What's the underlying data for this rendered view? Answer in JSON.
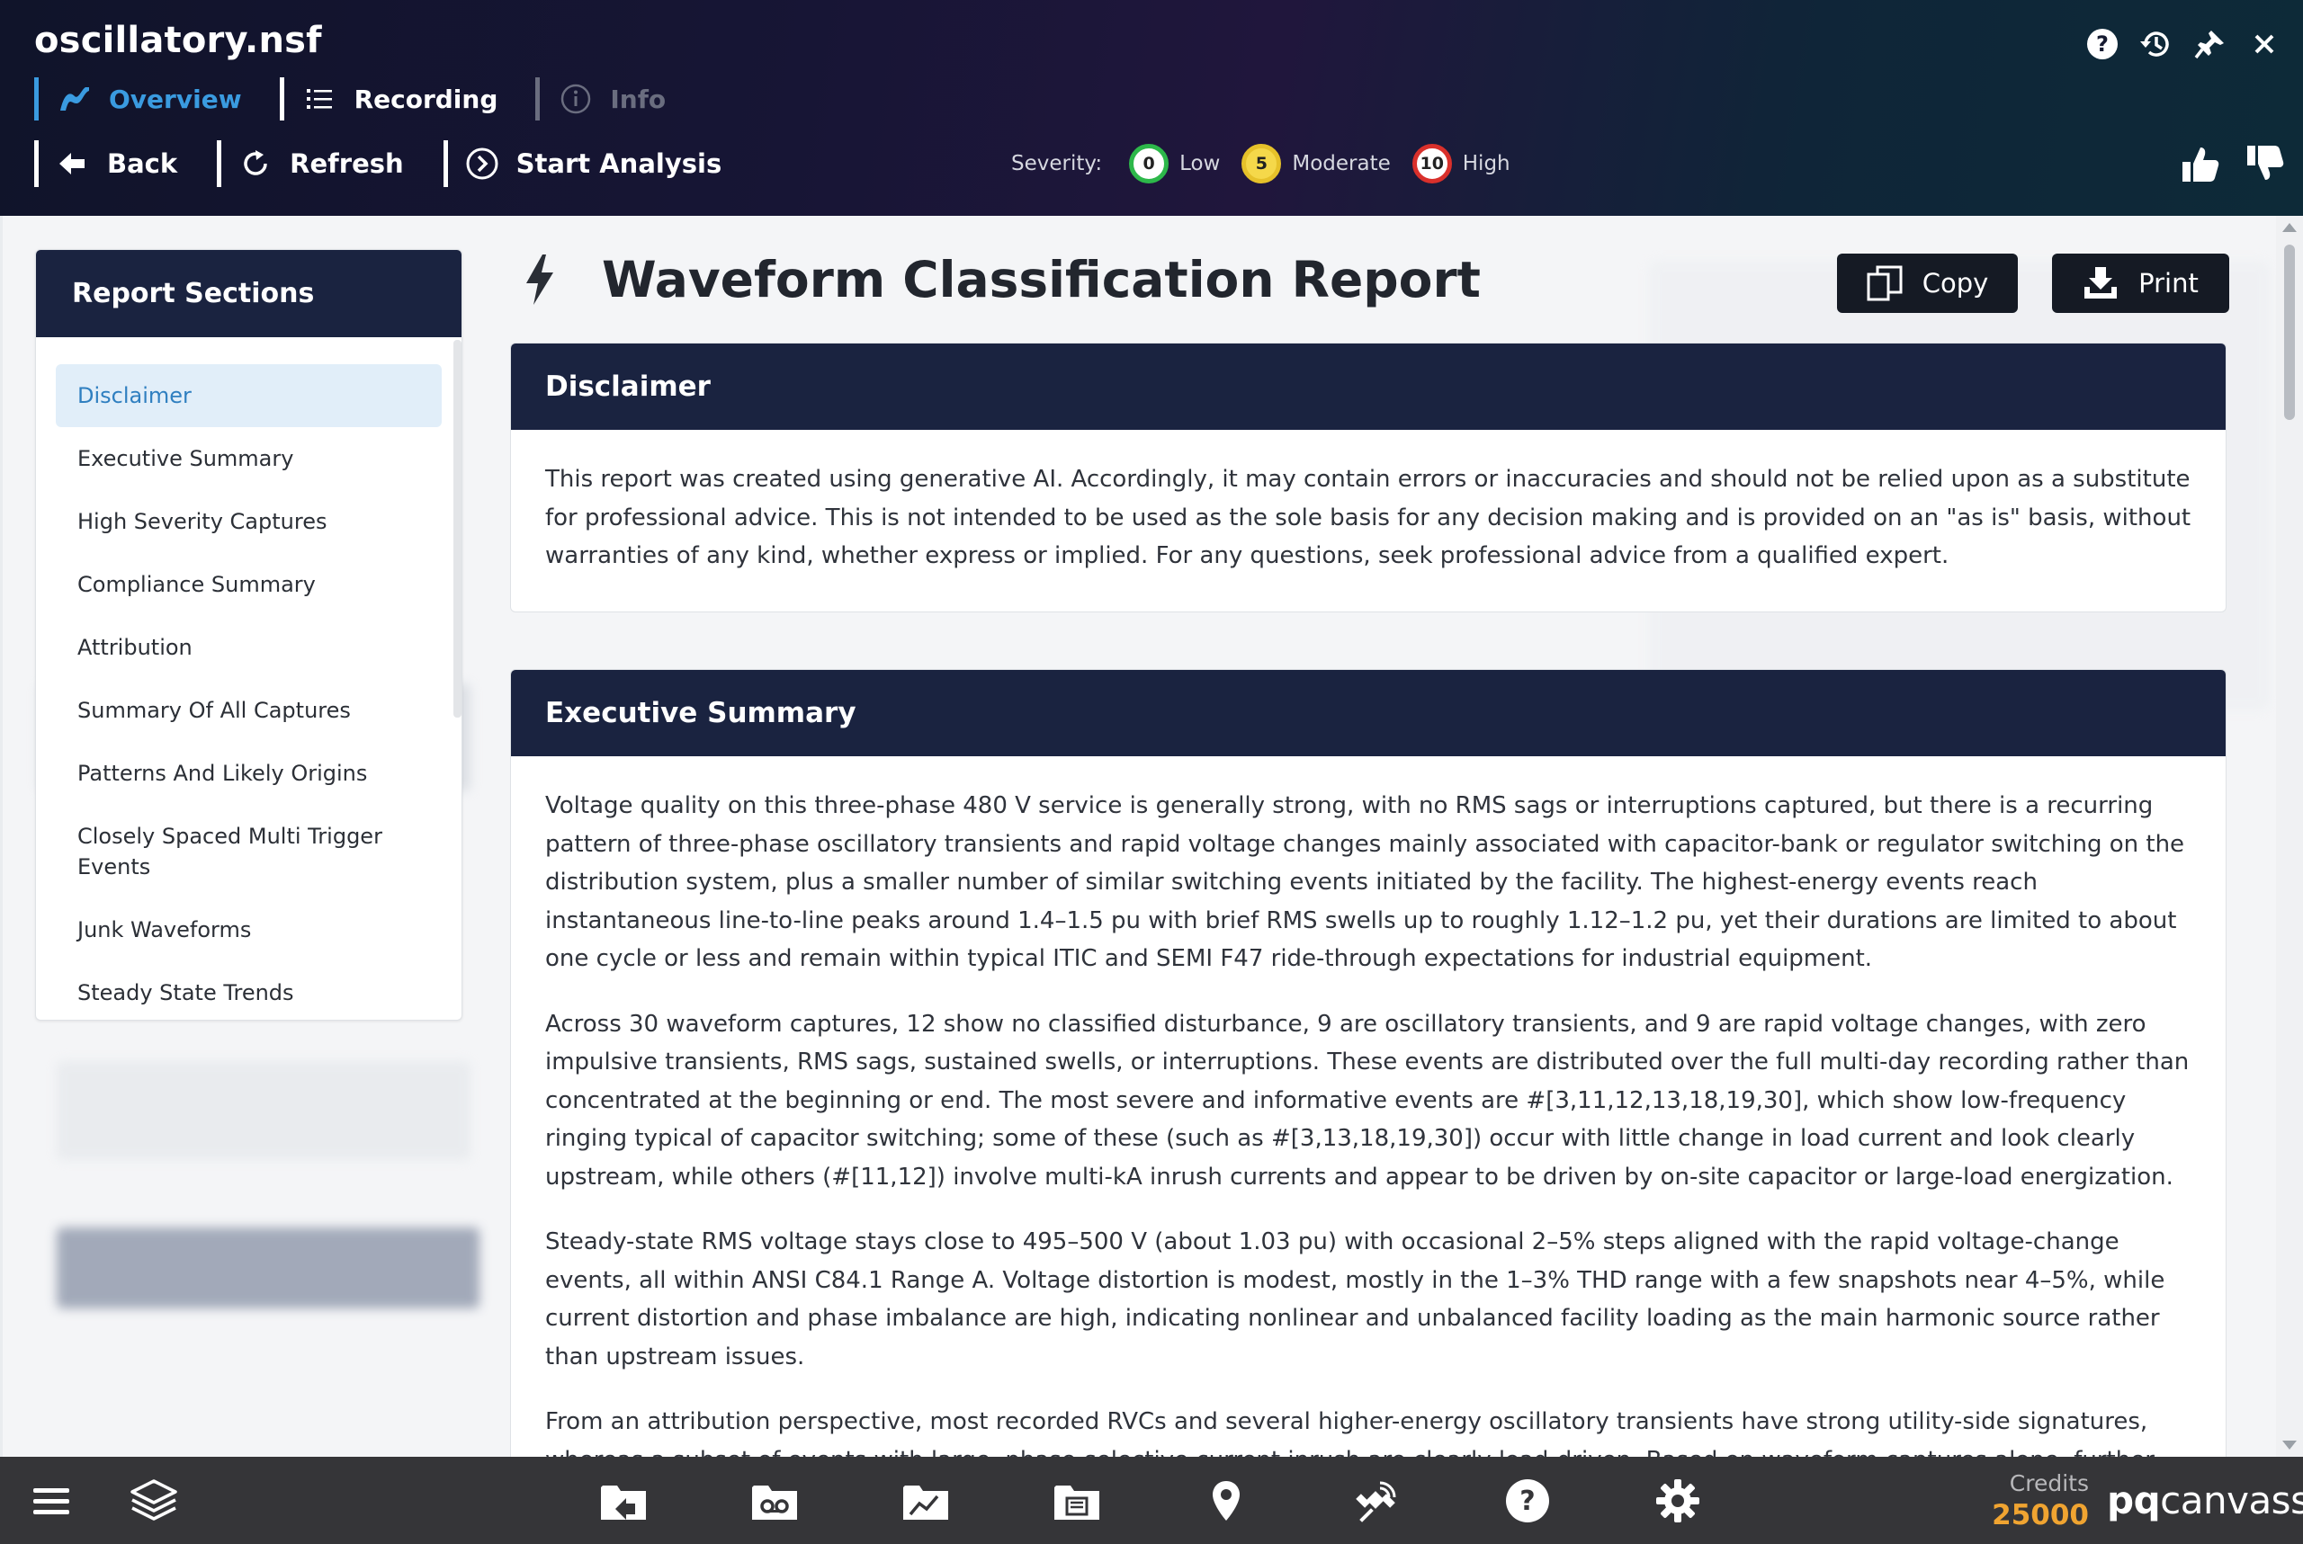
{
  "app": {
    "title": "oscillatory.nsf"
  },
  "tabs": [
    {
      "label": "Overview",
      "icon": "waveform-icon",
      "state": "active"
    },
    {
      "label": "Recording",
      "icon": "list-icon",
      "state": "normal"
    },
    {
      "label": "Info",
      "icon": "info-icon",
      "state": "disabled"
    }
  ],
  "toolbar": {
    "back": "Back",
    "refresh": "Refresh",
    "start_analysis": "Start Analysis"
  },
  "severity": {
    "label": "Severity:",
    "levels": [
      {
        "count": "0",
        "label": "Low",
        "color": "#2db84a"
      },
      {
        "count": "5",
        "label": "Moderate",
        "color": "#e6c12a"
      },
      {
        "count": "10",
        "label": "High",
        "color": "#d9302b"
      }
    ]
  },
  "sections": {
    "title": "Report Sections",
    "items": [
      "Disclaimer",
      "Executive Summary",
      "High Severity Captures",
      "Compliance Summary",
      "Attribution",
      "Summary Of All Captures",
      "Patterns And Likely Origins",
      "Closely Spaced Multi Trigger Events",
      "Junk Waveforms",
      "Steady State Trends"
    ],
    "active_index": 0
  },
  "report": {
    "title": "Waveform Classification Report",
    "copy_label": "Copy",
    "print_label": "Print",
    "disclaimer": {
      "heading": "Disclaimer",
      "text": "This report was created using generative AI. Accordingly, it may contain errors or inaccuracies and should not be relied upon as a substitute for professional advice. This is not intended to be used as the sole basis for any decision making and is provided on an \"as is\" basis, without warranties of any kind, whether express or implied. For any questions, seek professional advice from a qualified expert."
    },
    "executive_summary": {
      "heading": "Executive Summary",
      "paragraphs": [
        "Voltage quality on this three-phase 480 V service is generally strong, with no RMS sags or interruptions captured, but there is a recurring pattern of three-phase oscillatory transients and rapid voltage changes mainly associated with capacitor-bank or regulator switching on the distribution system, plus a smaller number of similar switching events initiated by the facility. The highest-energy events reach instantaneous line-to-line peaks around 1.4–1.5 pu with brief RMS swells up to roughly 1.12–1.2 pu, yet their durations are limited to about one cycle or less and remain within typical ITIC and SEMI F47 ride-through expectations for industrial equipment.",
        "Across 30 waveform captures, 12 show no classified disturbance, 9 are oscillatory transients, and 9 are rapid voltage changes, with zero impulsive transients, RMS sags, sustained swells, or interruptions. These events are distributed over the full multi-day recording rather than concentrated at the beginning or end. The most severe and informative events are #[3,11,12,13,18,19,30], which show low-frequency ringing typical of capacitor switching; some of these (such as #[3,13,18,19,30]) occur with little change in load current and look clearly upstream, while others (#[11,12]) involve multi-kA inrush currents and appear to be driven by on-site capacitor or large-load energization.",
        "Steady-state RMS voltage stays close to 495–500 V (about 1.03 pu) with occasional 2–5% steps aligned with the rapid voltage-change events, all within ANSI C84.1 Range A. Voltage distortion is modest, mostly in the 1–3% THD range with a few snapshots near 4–5%, while current distortion and phase imbalance are high, indicating nonlinear and unbalanced facility loading as the main harmonic source rather than upstream issues.",
        "From an attribution perspective, most recorded RVCs and several higher-energy oscillatory transients have strong utility-side signatures, whereas a subset of events with large, phase-selective current inrush are clearly load-driven. Based on waveform captures alone, further investigation should"
      ]
    }
  },
  "footer": {
    "icons": [
      "menu-icon",
      "layers-icon",
      "folder-upload-icon",
      "voicemail-icon",
      "chart-folder-icon",
      "report-folder-icon",
      "location-pin-icon",
      "satellite-icon",
      "help-icon",
      "settings-icon"
    ],
    "credits_label": "Credits",
    "credits_value": "25000",
    "brand_bold": "pq",
    "brand_rest": "canvass"
  },
  "colors": {
    "accent": "#3a9be0",
    "header_navy": "#1a2340",
    "credits": "#f0a431",
    "footer_bg": "#353538"
  }
}
